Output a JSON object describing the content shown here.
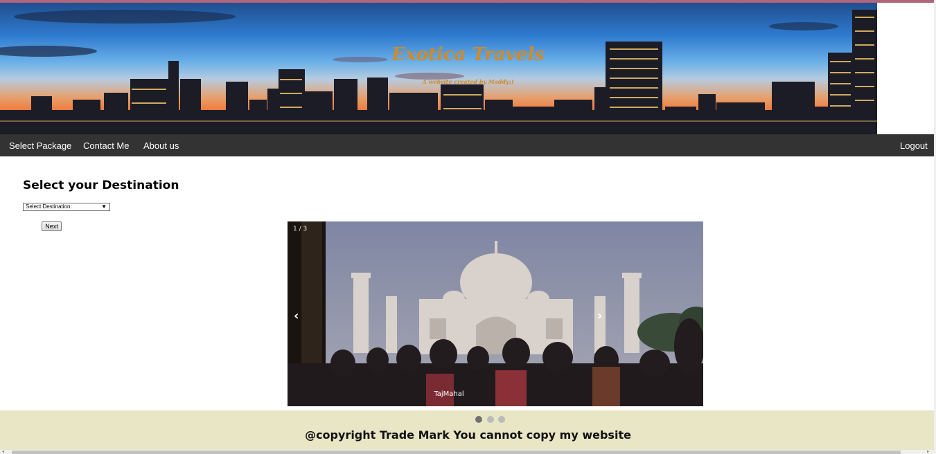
{
  "header": {
    "title": "Exotica Travels",
    "subtitle": "A website created by Maddy:)"
  },
  "nav": {
    "items": [
      "Select Package",
      "Contact Me",
      "About us"
    ],
    "logout": "Logout"
  },
  "main": {
    "heading": "Select your Destination",
    "select": {
      "value": "Select Destination:",
      "arrow": "▼"
    },
    "next_label": "Next"
  },
  "slideshow": {
    "counter": "1 / 3",
    "prev": "‹",
    "next": "›",
    "caption": "TajMahal",
    "total_slides": 3,
    "active_index": 0
  },
  "footer": {
    "text": "@copyright Trade Mark You cannot copy my website"
  },
  "colors": {
    "nav_bg": "#333333",
    "title": "#d08a2a",
    "footer_bg": "#e8e6c4",
    "dot_active": "#717171",
    "dot_inactive": "#bbbbbb"
  }
}
